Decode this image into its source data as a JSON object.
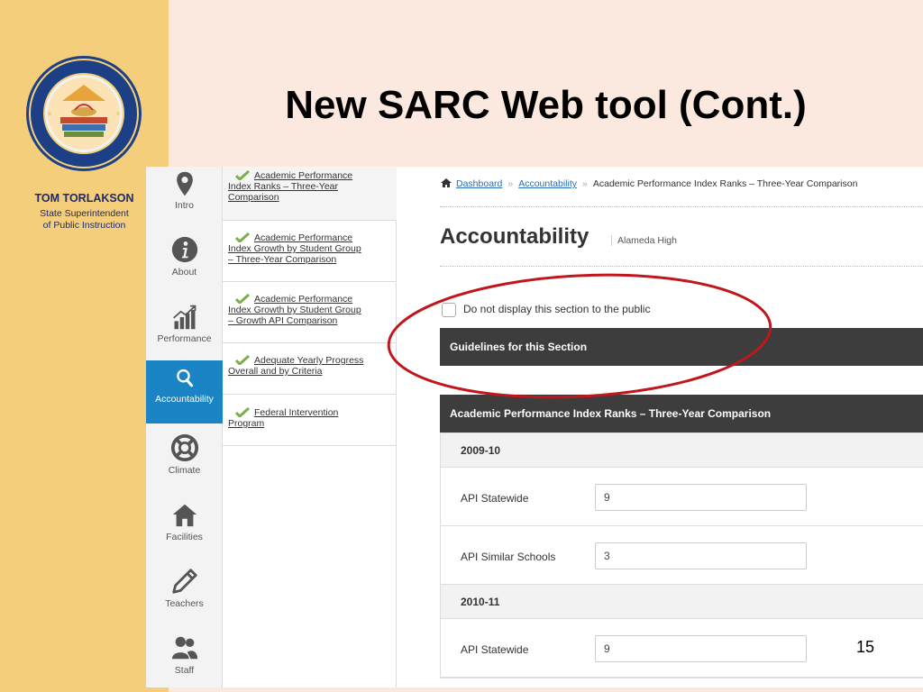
{
  "slide": {
    "title": "New SARC Web tool (Cont.)",
    "page_number": "15",
    "person_name": "TOM TORLAKSON",
    "person_title_line1": "State Superintendent",
    "person_title_line2": "of Public Instruction",
    "seal_name": "department-of-education-seal"
  },
  "nav": {
    "items": [
      {
        "label": "Intro",
        "icon": "map-pin-icon"
      },
      {
        "label": "About",
        "icon": "info-icon"
      },
      {
        "label": "Performance",
        "icon": "bar-chart-icon"
      },
      {
        "label": "Accountability",
        "icon": "search-icon"
      },
      {
        "label": "Climate",
        "icon": "lifebuoy-icon"
      },
      {
        "label": "Facilities",
        "icon": "home-icon"
      },
      {
        "label": "Teachers",
        "icon": "pencil-icon"
      },
      {
        "label": "Staff",
        "icon": "users-icon"
      }
    ],
    "active": "Accountability"
  },
  "sections": [
    {
      "lines": [
        "Academic Performance",
        "Index Ranks – Three-Year",
        "Comparison"
      ]
    },
    {
      "lines": [
        "Academic Performance",
        "Index Growth by Student Group",
        "– Three-Year Comparison"
      ]
    },
    {
      "lines": [
        "Academic Performance",
        "Index Growth by Student Group",
        "– Growth API Comparison"
      ]
    },
    {
      "lines": [
        "Adequate Yearly Progress",
        "Overall and by Criteria"
      ]
    },
    {
      "lines": [
        "Federal Intervention",
        "Program"
      ]
    }
  ],
  "breadcrumb": {
    "home": "Dashboard",
    "level2": "Accountability",
    "current": "Academic Performance Index Ranks – Three-Year Comparison"
  },
  "main": {
    "title": "Accountability",
    "school": "Alameda High",
    "hide_checkbox_label": "Do not display this section to the public",
    "guidelines_label": "Guidelines for this Section",
    "table_header": "Academic Performance Index Ranks – Three-Year Comparison",
    "years": [
      {
        "year": "2009-10",
        "fields": [
          {
            "label": "API Statewide",
            "value": "9"
          },
          {
            "label": "API Similar Schools",
            "value": "3"
          }
        ]
      },
      {
        "year": "2010-11",
        "fields": [
          {
            "label": "API Statewide",
            "value": "9"
          }
        ]
      }
    ]
  },
  "colors": {
    "gold_panel": "#f4ce7b",
    "slide_bg": "#fbe9df",
    "accent_blue": "#1b84c4",
    "dark_bar": "#3d3d3d",
    "annotation_red": "#c0161c"
  }
}
